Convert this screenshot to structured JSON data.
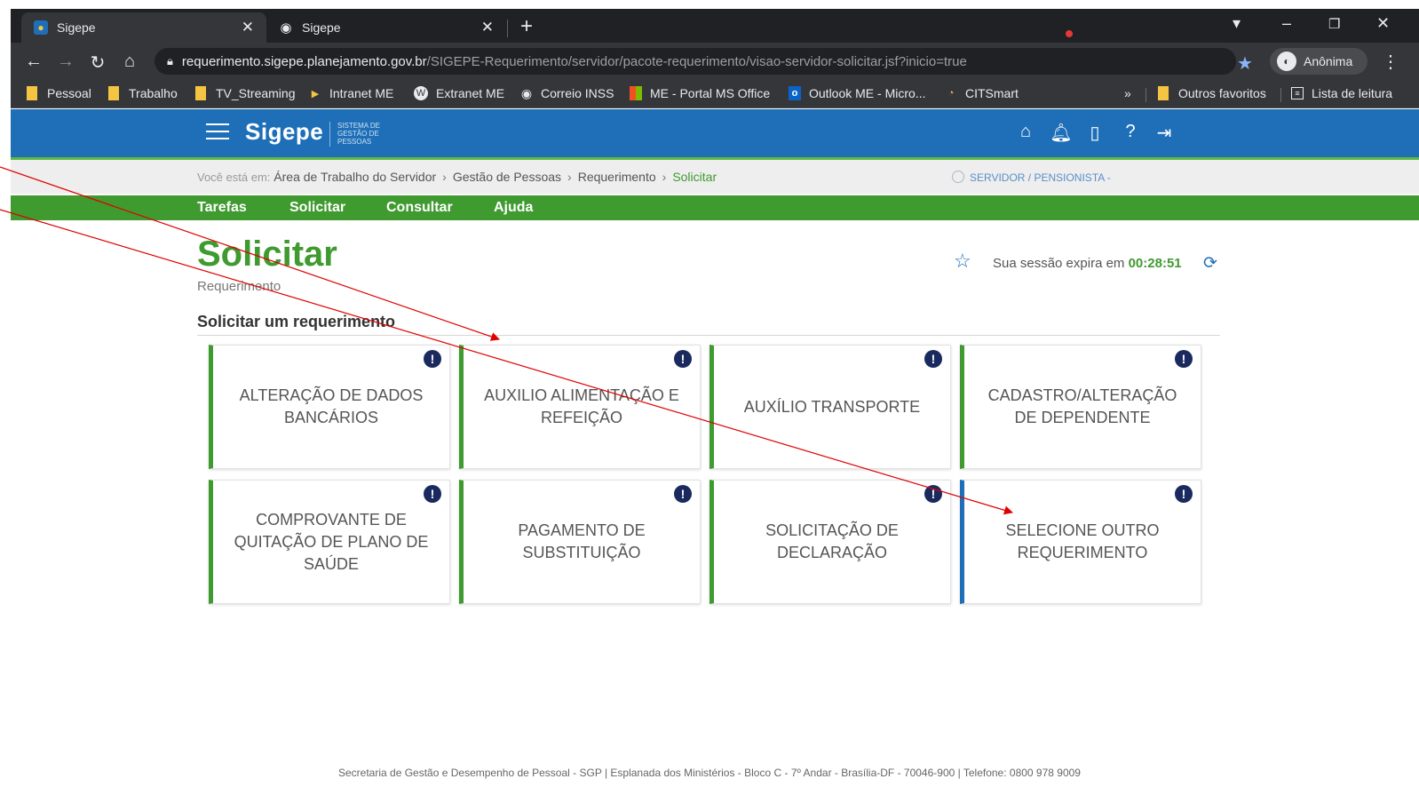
{
  "browser": {
    "tabs": [
      {
        "title": "Sigepe",
        "active": true
      },
      {
        "title": "Sigepe",
        "active": false
      }
    ],
    "new_tab": "+",
    "window_controls": {
      "minimize": "–",
      "restore": "❐",
      "close": "✕"
    },
    "url_host": "requerimento.sigepe.planejamento.gov.br",
    "url_path": "/SIGEPE-Requerimento/servidor/pacote-requerimento/visao-servidor-solicitar.jsf?inicio=true",
    "profile_name": "Anônima",
    "bookmarks": [
      "Pessoal",
      "Trabalho",
      "TV_Streaming",
      "Intranet ME",
      "Extranet ME",
      "Correio INSS",
      "ME - Portal MS Office",
      "Outlook ME - Micro...",
      "CITSmart"
    ],
    "bookmarks_overflow": "»",
    "other_bookmarks": "Outros favoritos",
    "reading_list": "Lista de leitura"
  },
  "header": {
    "logo": "Sigepe",
    "logo_subtitle": "SISTEMA DE GESTÃO DE PESSOAS"
  },
  "breadcrumb": {
    "lead": "Você está em:",
    "items": [
      "Área de Trabalho do Servidor",
      "Gestão de Pessoas",
      "Requerimento"
    ],
    "current": "Solicitar",
    "separator": "›",
    "profile": "SERVIDOR / PENSIONISTA -"
  },
  "menu": [
    "Tarefas",
    "Solicitar",
    "Consultar",
    "Ajuda"
  ],
  "page": {
    "title": "Solicitar",
    "subtitle": "Requerimento",
    "session_prefix": "Sua sessão expira em",
    "session_time": "00:28:51",
    "section_title": "Solicitar um requerimento"
  },
  "cards": [
    {
      "label": "ALTERAÇÃO DE DADOS BANCÁRIOS",
      "accent": "#3f9a2f"
    },
    {
      "label": "AUXILIO ALIMENTAÇÃO E REFEIÇÃO",
      "accent": "#3f9a2f"
    },
    {
      "label": "AUXÍLIO TRANSPORTE",
      "accent": "#3f9a2f"
    },
    {
      "label": "CADASTRO/ALTERAÇÃO DE DEPENDENTE",
      "accent": "#3f9a2f"
    },
    {
      "label": "COMPROVANTE DE QUITAÇÃO DE PLANO DE SAÚDE",
      "accent": "#3f9a2f"
    },
    {
      "label": "PAGAMENTO DE SUBSTITUIÇÃO",
      "accent": "#3f9a2f"
    },
    {
      "label": "SOLICITAÇÃO DE DECLARAÇÃO",
      "accent": "#3f9a2f"
    },
    {
      "label": "SELECIONE OUTRO REQUERIMENTO",
      "accent": "#1e6fb8"
    }
  ],
  "card_info_glyph": "!",
  "footer": "Secretaria de Gestão e Desempenho de Pessoal - SGP | Esplanada dos Ministérios - Bloco C - 7º Andar - Brasília-DF - 70046-900 | Telefone: 0800 978 9009",
  "colors": {
    "header_blue": "#1e6fb8",
    "sigepe_green": "#3f9a2f",
    "annotation_red": "#e00000"
  }
}
